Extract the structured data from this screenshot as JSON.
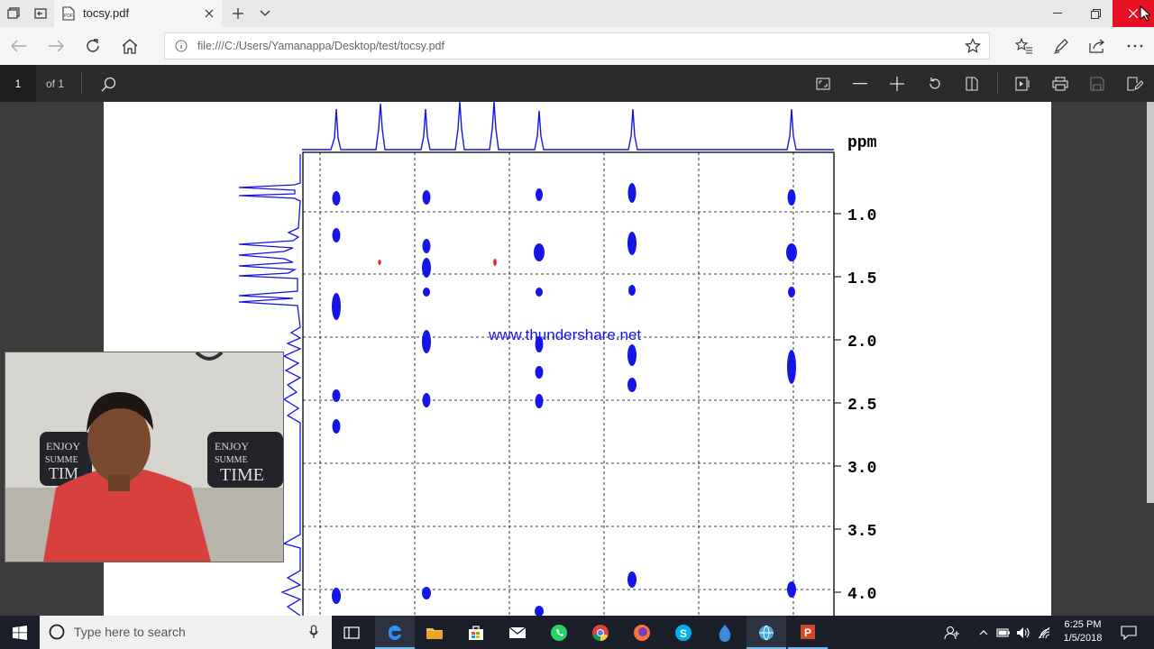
{
  "browser": {
    "tab_title": "tocsy.pdf",
    "url": "file:///C:/Users/Yamanappa/Desktop/test/tocsy.pdf"
  },
  "pdf": {
    "page_number": "1",
    "page_count": "of 1"
  },
  "document": {
    "axis_label": "ppm",
    "watermark": "www.thundershare.net",
    "tick_labels": [
      "1.0",
      "1.5",
      "2.0",
      "2.5",
      "3.0",
      "3.5",
      "4.0"
    ]
  },
  "taskbar": {
    "search_placeholder": "Type here to search",
    "time": "6:25 PM",
    "date": "1/5/2018"
  },
  "colors": {
    "spectrum": "#1515e8",
    "negative_peak": "#e82020",
    "close_button": "#e81123"
  }
}
